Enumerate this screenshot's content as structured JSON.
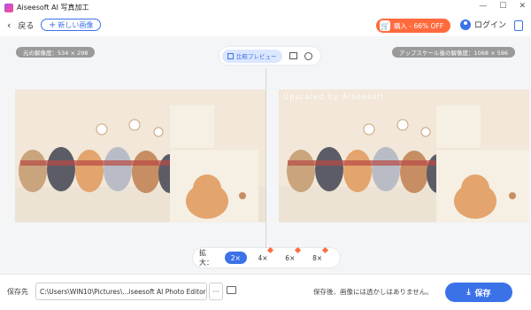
{
  "titlebar": {
    "app_title": "Aiseesoft AI 写真加工",
    "controls": [
      "—",
      "☐",
      "✕"
    ]
  },
  "toolbar": {
    "back_label": "戻る",
    "new_image_label": "新しい画像",
    "promo_label": "購入 - 66% OFF",
    "login_label": "ログイン"
  },
  "main": {
    "original_resolution": "元の解像度：534 × 298",
    "upscaled_resolution": "アップスケール後の解像度：1068 × 596",
    "compare_preview_label": "比較プレビュー",
    "watermark": "Upscaled by Aiseesoft",
    "zoom": {
      "label": "拡大：",
      "options": [
        "2×",
        "4×",
        "6×",
        "8×"
      ],
      "selected": "2×"
    }
  },
  "footer": {
    "save_to_label": "保存先",
    "path": "C:\\Users\\WIN10\\Pictures\\...iseesoft AI Photo Editor",
    "browse_label": "···",
    "note": "保存後、画像には透かしはありません。",
    "save_label": "保存"
  },
  "colors": {
    "accent": "#3c72e8",
    "promo": "#ff6a3d",
    "image_bg": "#f2e7d8"
  }
}
